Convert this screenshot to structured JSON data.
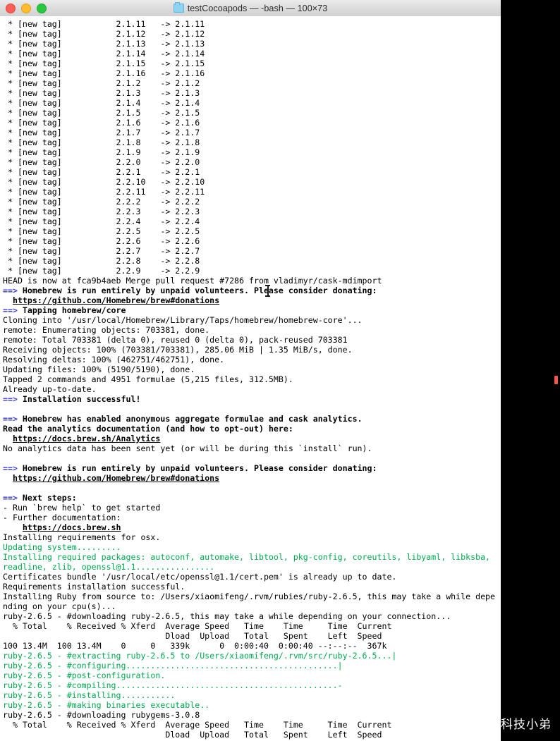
{
  "window": {
    "title": "testCocoapods — -bash — 100×73",
    "folder_icon": "folder-icon",
    "traffic_lights": [
      "close-button",
      "minimize-button",
      "maximize-button"
    ]
  },
  "watermark": {
    "text": "科技小弟",
    "logo": "panda-face-logo"
  },
  "terminal": {
    "tag_label": "* [new tag]",
    "arrow": "->",
    "tags": [
      "2.1.11",
      "2.1.12",
      "2.1.13",
      "2.1.14",
      "2.1.15",
      "2.1.16",
      "2.1.2",
      "2.1.3",
      "2.1.4",
      "2.1.5",
      "2.1.6",
      "2.1.7",
      "2.1.8",
      "2.1.9",
      "2.2.0",
      "2.2.1",
      "2.2.10",
      "2.2.11",
      "2.2.2",
      "2.2.3",
      "2.2.4",
      "2.2.5",
      "2.2.6",
      "2.2.7",
      "2.2.8",
      "2.2.9"
    ],
    "lines": [
      {
        "t": "plain",
        "text": "HEAD is now at fca9b4aeb Merge pull request #7286 from vladimyr/cask-mdimport"
      },
      {
        "t": "arrow",
        "text": "Homebrew is run entirely by unpaid volunteers. Please consider donating:"
      },
      {
        "t": "link",
        "text": "  https://github.com/Homebrew/brew#donations"
      },
      {
        "t": "arrow",
        "text": "Tapping homebrew/core"
      },
      {
        "t": "plain",
        "text": "Cloning into '/usr/local/Homebrew/Library/Taps/homebrew/homebrew-core'..."
      },
      {
        "t": "plain",
        "text": "remote: Enumerating objects: 703381, done."
      },
      {
        "t": "plain",
        "text": "remote: Total 703381 (delta 0), reused 0 (delta 0), pack-reused 703381"
      },
      {
        "t": "plain",
        "text": "Receiving objects: 100% (703381/703381), 285.06 MiB | 1.35 MiB/s, done."
      },
      {
        "t": "plain",
        "text": "Resolving deltas: 100% (462751/462751), done."
      },
      {
        "t": "plain",
        "text": "Updating files: 100% (5190/5190), done."
      },
      {
        "t": "plain",
        "text": "Tapped 2 commands and 4951 formulae (5,215 files, 312.5MB)."
      },
      {
        "t": "plain",
        "text": "Already up-to-date."
      },
      {
        "t": "arrow",
        "text": "Installation successful!"
      },
      {
        "t": "plain",
        "text": ""
      },
      {
        "t": "arrow",
        "text": "Homebrew has enabled anonymous aggregate formulae and cask analytics."
      },
      {
        "t": "bold",
        "text": "Read the analytics documentation (and how to opt-out) here:"
      },
      {
        "t": "link",
        "text": "  https://docs.brew.sh/Analytics"
      },
      {
        "t": "plain",
        "text": "No analytics data has been sent yet (or will be during this `install` run)."
      },
      {
        "t": "plain",
        "text": ""
      },
      {
        "t": "arrow",
        "text": "Homebrew is run entirely by unpaid volunteers. Please consider donating:"
      },
      {
        "t": "link",
        "text": "  https://github.com/Homebrew/brew#donations"
      },
      {
        "t": "plain",
        "text": ""
      },
      {
        "t": "arrow",
        "text": "Next steps:"
      },
      {
        "t": "plain",
        "text": "- Run `brew help` to get started"
      },
      {
        "t": "plain",
        "text": "- Further documentation:"
      },
      {
        "t": "link",
        "text": "    https://docs.brew.sh"
      },
      {
        "t": "plain",
        "text": "Installing requirements for osx."
      },
      {
        "t": "green",
        "text": "Updating system........."
      },
      {
        "t": "green",
        "text": "Installing required packages: autoconf, automake, libtool, pkg-config, coreutils, libyaml, libksba,"
      },
      {
        "t": "green",
        "text": "readline, zlib, openssl@1.1................"
      },
      {
        "t": "plain",
        "text": "Certificates bundle '/usr/local/etc/openssl@1.1/cert.pem' is already up to date."
      },
      {
        "t": "plain",
        "text": "Requirements installation successful."
      },
      {
        "t": "plain",
        "text": "Installing Ruby from source to: /Users/xiaomifeng/.rvm/rubies/ruby-2.6.5, this may take a while depe"
      },
      {
        "t": "plain",
        "text": "nding on your cpu(s)..."
      },
      {
        "t": "plain",
        "text": "ruby-2.6.5 - #downloading ruby-2.6.5, this may take a while depending on your connection..."
      },
      {
        "t": "plain",
        "text": "  % Total    % Received % Xferd  Average Speed   Time    Time     Time  Current"
      },
      {
        "t": "plain",
        "text": "                                 Dload  Upload   Total   Spent    Left  Speed"
      },
      {
        "t": "plain",
        "text": "100 13.4M  100 13.4M    0     0   339k      0  0:00:40  0:00:40 --:--:--  367k"
      },
      {
        "t": "green",
        "text": "ruby-2.6.5 - #extracting ruby-2.6.5 to /Users/xiaomifeng/.rvm/src/ruby-2.6.5...|"
      },
      {
        "t": "green",
        "text": "ruby-2.6.5 - #configuring...........................................|"
      },
      {
        "t": "green",
        "text": "ruby-2.6.5 - #post-configuration."
      },
      {
        "t": "green",
        "text": "ruby-2.6.5 - #compiling.............................................-"
      },
      {
        "t": "green",
        "text": "ruby-2.6.5 - #installing..........."
      },
      {
        "t": "green",
        "text": "ruby-2.6.5 - #making binaries executable.."
      },
      {
        "t": "plain",
        "text": "ruby-2.6.5 - #downloading rubygems-3.0.8"
      },
      {
        "t": "plain",
        "text": "  % Total    % Received % Xferd  Average Speed   Time    Time     Time  Current"
      },
      {
        "t": "plain",
        "text": "                                 Dload  Upload   Total   Spent    Left  Speed"
      }
    ]
  }
}
